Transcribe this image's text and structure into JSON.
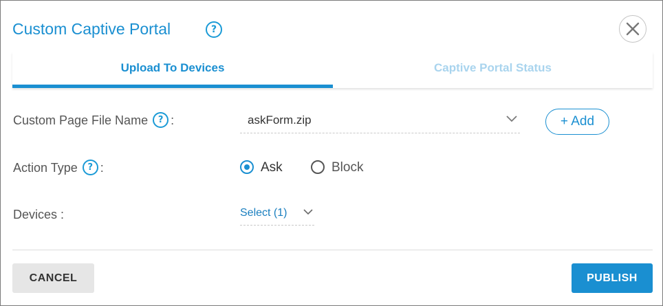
{
  "dialog": {
    "title": "Custom Captive Portal",
    "help_glyph": "?",
    "close_icon": "close-icon"
  },
  "tabs": [
    {
      "label": "Upload To Devices",
      "active": true
    },
    {
      "label": "Captive Portal Status",
      "active": false
    }
  ],
  "form": {
    "file_name": {
      "label": "Custom Page File Name",
      "separator": ":",
      "value": "askForm.zip",
      "add_label": "+ Add"
    },
    "action_type": {
      "label": "Action Type",
      "separator": ":",
      "options": [
        {
          "label": "Ask",
          "selected": true
        },
        {
          "label": "Block",
          "selected": false
        }
      ]
    },
    "devices": {
      "label": "Devices :",
      "value": "Select (1)"
    }
  },
  "footer": {
    "cancel_label": "CANCEL",
    "publish_label": "PUBLISH"
  },
  "colors": {
    "accent": "#1a8fd1",
    "inactive_tab": "#a9d4ee",
    "label_text": "#555555",
    "cancel_bg": "#e6e6e6"
  }
}
